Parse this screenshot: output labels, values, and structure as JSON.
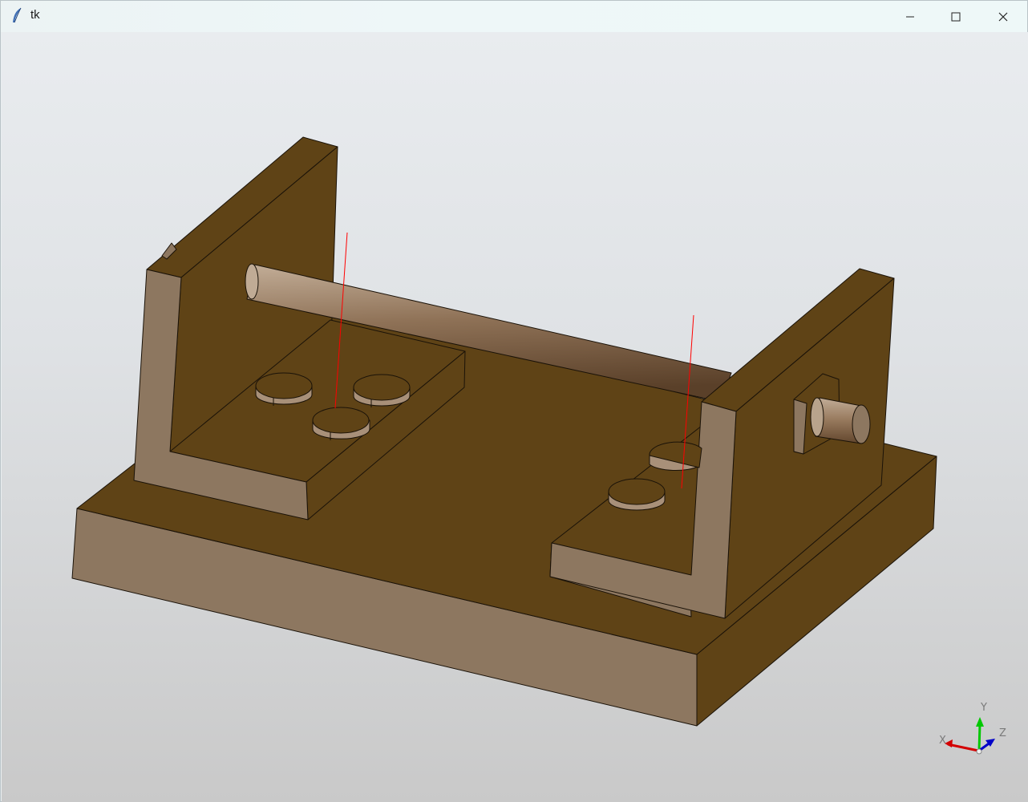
{
  "window": {
    "title": "tk",
    "icon": "tk-feather-icon",
    "controls": [
      "minimize-icon",
      "maximize-icon",
      "close-icon"
    ]
  },
  "viewer": {
    "background": [
      "#e9ecef",
      "#c9c9c9"
    ],
    "model_color": "#5f4316",
    "model_light_face": "#8d7760",
    "axis_line_color": "#ff0000"
  },
  "axis_triad": {
    "x_label": "X",
    "y_label": "Y",
    "z_label": "Z",
    "x_color": "#d40000",
    "y_color": "#00c800",
    "z_color": "#0000c8"
  }
}
